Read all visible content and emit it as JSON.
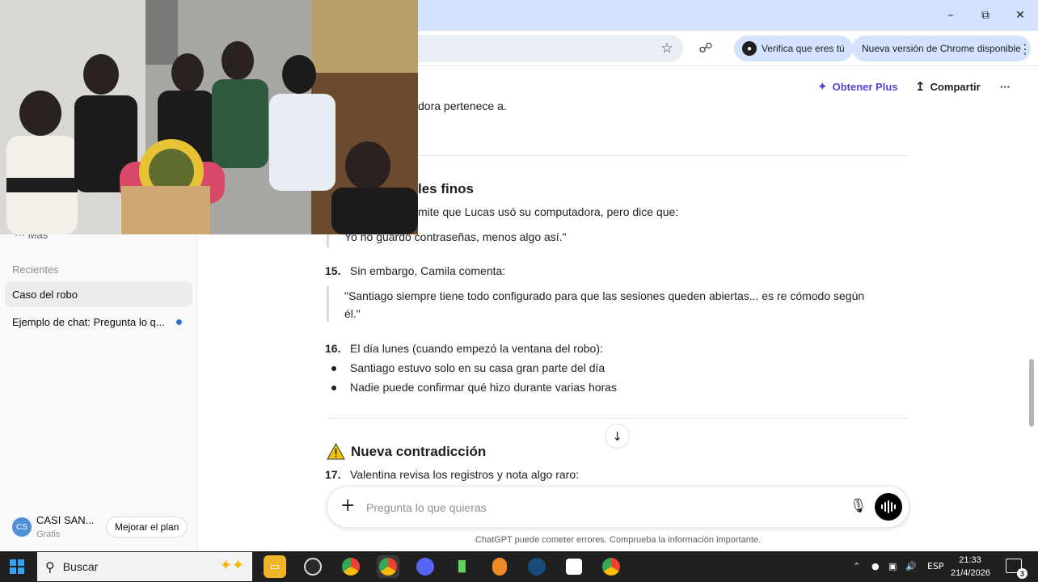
{
  "browser": {
    "verify_label": "Verifica que eres tú",
    "update_label": "Nueva versión de Chrome disponible",
    "window_controls": [
      "minimize-icon",
      "restore-icon",
      "close-icon"
    ]
  },
  "header": {
    "plus_label": "Obtener Plus",
    "share_label": "Compartir",
    "more_icon": "ellipsis-icon"
  },
  "sidebar": {
    "more_label": "Más",
    "section_label": "Recientes",
    "items": [
      {
        "label": "Caso del robo",
        "active": true
      },
      {
        "label": "Ejemplo de chat: Pregunta lo q...",
        "unread": true
      }
    ],
    "user": {
      "initials": "CS",
      "name": "CASI SAN...",
      "plan": "Gratis"
    },
    "upgrade_label": "Mejorar el plan"
  },
  "chat": {
    "partial_top": "dora pertenece a.",
    "section_heading": "les finos",
    "line_intro": "mite que Lucas usó su computadora, pero dice que:",
    "quote_1": "Yo no guardo contraseñas, menos algo así.\"",
    "item_15": {
      "num": "15.",
      "text": "Sin embargo, Camila comenta:"
    },
    "quote_2_line1": "\"Santiago siempre tiene todo configurado para que las sesiones queden abiertas... es re cómodo según",
    "quote_2_line2": "él.\"",
    "item_16": {
      "num": "16.",
      "text": "El día lunes (cuando empezó la ventana del robo):"
    },
    "bullets": [
      "Santiago estuvo solo en su casa gran parte del día",
      "Nadie puede confirmar qué hizo durante varias horas"
    ],
    "new_heading": "Nueva contradicción",
    "item_17": {
      "num": "17.",
      "text": "Valentina revisa los registros y nota algo raro:"
    }
  },
  "composer": {
    "placeholder": "Pregunta lo que quieras",
    "disclaimer": "ChatGPT puede cometer errores. Comprueba la información importante."
  },
  "taskbar": {
    "search_label": "Buscar",
    "language": "ESP",
    "time": "21:33",
    "date": "21/4/2026",
    "notifications": "3",
    "apps": [
      "file-explorer-icon",
      "obs-icon",
      "chrome-icon",
      "chrome-icon",
      "discord-icon",
      "stats-icon",
      "fl-studio-icon",
      "steam-icon",
      "capcut-icon",
      "chrome-icon"
    ]
  },
  "colors": {
    "accent": "#5b3fd6",
    "browser_frame": "#d3e3fd",
    "taskbar": "#202020",
    "warning": "#f5c400"
  }
}
